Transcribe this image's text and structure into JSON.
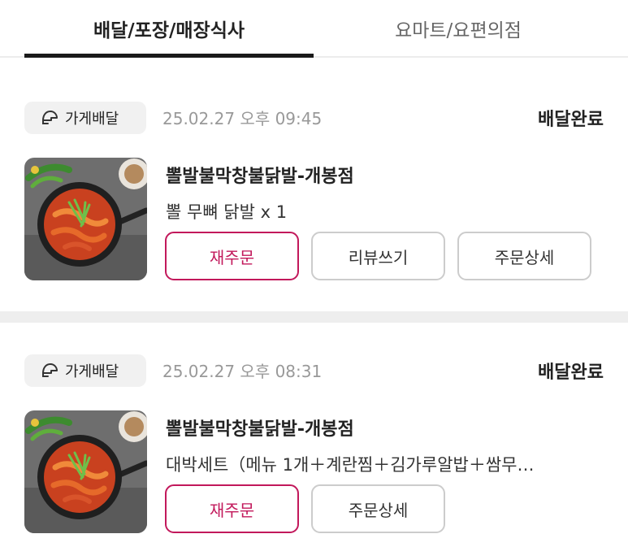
{
  "tabs": [
    {
      "label": "배달/포장/매장식사",
      "active": true
    },
    {
      "label": "요마트/요편의점",
      "active": false
    }
  ],
  "orders": [
    {
      "badge": "가게배달",
      "datetime": "25.02.27 오후 09:45",
      "status": "배달완료",
      "store": "뽈발불막창불닭발-개봉점",
      "menu": "뽈 무뼈 닭발 x 1",
      "buttons": [
        "재주문",
        "리뷰쓰기",
        "주문상세"
      ]
    },
    {
      "badge": "가게배달",
      "datetime": "25.02.27 오후 08:31",
      "status": "배달완료",
      "store": "뽈발불막창불닭발-개봉점",
      "menu": "대박세트（메뉴 1개＋계란찜＋김가루알밥＋쌈무…",
      "buttons": [
        "재주문",
        "주문상세"
      ]
    }
  ],
  "colors": {
    "accent": "#c2185b",
    "tab_indicator": "#1a1a1a",
    "badge_bg": "#f1f1f1",
    "divider": "#eeeeee"
  },
  "icons": {
    "badge": "scooter-helmet-icon",
    "thumbnail": "food-thumbnail"
  }
}
